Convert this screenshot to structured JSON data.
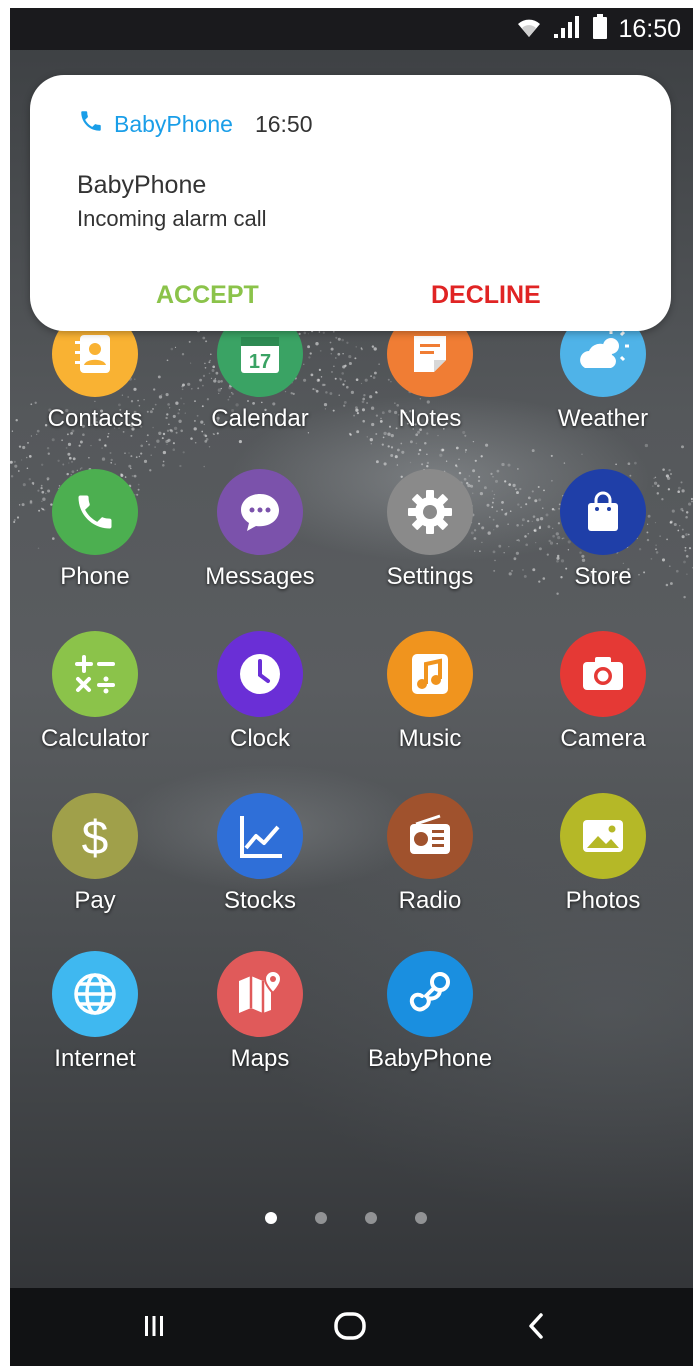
{
  "status_bar": {
    "time": "16:50",
    "icons": [
      "wifi-icon",
      "signal-icon",
      "battery-icon"
    ]
  },
  "notification": {
    "app_name": "BabyPhone",
    "time": "16:50",
    "title": "BabyPhone",
    "body": "Incoming alarm call",
    "accept_label": "ACCEPT",
    "decline_label": "DECLINE",
    "app_color": "#1a9ee8",
    "accept_color": "#8bc34a",
    "decline_color": "#e02424"
  },
  "apps": [
    {
      "label": "Contacts",
      "icon": "contacts-icon",
      "color": "#f9b233"
    },
    {
      "label": "Calendar",
      "icon": "calendar-icon",
      "color": "#3aa364",
      "day": "17"
    },
    {
      "label": "Notes",
      "icon": "notes-icon",
      "color": "#f07d34"
    },
    {
      "label": "Weather",
      "icon": "weather-icon",
      "color": "#4fb3e8"
    },
    {
      "label": "Phone",
      "icon": "phone-icon",
      "color": "#4caf50"
    },
    {
      "label": "Messages",
      "icon": "messages-icon",
      "color": "#7b52ab"
    },
    {
      "label": "Settings",
      "icon": "settings-icon",
      "color": "#8a8a8a"
    },
    {
      "label": "Store",
      "icon": "store-icon",
      "color": "#1f3fa8"
    },
    {
      "label": "Calculator",
      "icon": "calculator-icon",
      "color": "#8bc34a"
    },
    {
      "label": "Clock",
      "icon": "clock-icon",
      "color": "#6a2fd6"
    },
    {
      "label": "Music",
      "icon": "music-icon",
      "color": "#f0941e"
    },
    {
      "label": "Camera",
      "icon": "camera-icon",
      "color": "#e53935"
    },
    {
      "label": "Pay",
      "icon": "pay-icon",
      "color": "#a0a04a"
    },
    {
      "label": "Stocks",
      "icon": "stocks-icon",
      "color": "#2f6fd8"
    },
    {
      "label": "Radio",
      "icon": "radio-icon",
      "color": "#a0522d"
    },
    {
      "label": "Photos",
      "icon": "photos-icon",
      "color": "#b5b827"
    },
    {
      "label": "Internet",
      "icon": "globe-icon",
      "color": "#3fb8f0"
    },
    {
      "label": "Maps",
      "icon": "maps-icon",
      "color": "#e05a5a"
    },
    {
      "label": "BabyPhone",
      "icon": "pacifier-icon",
      "color": "#1a8fe0"
    }
  ],
  "page_indicator": {
    "total": 4,
    "active": 1
  },
  "nav_bar": {
    "buttons": [
      "recent-apps-icon",
      "home-icon",
      "back-icon"
    ]
  }
}
